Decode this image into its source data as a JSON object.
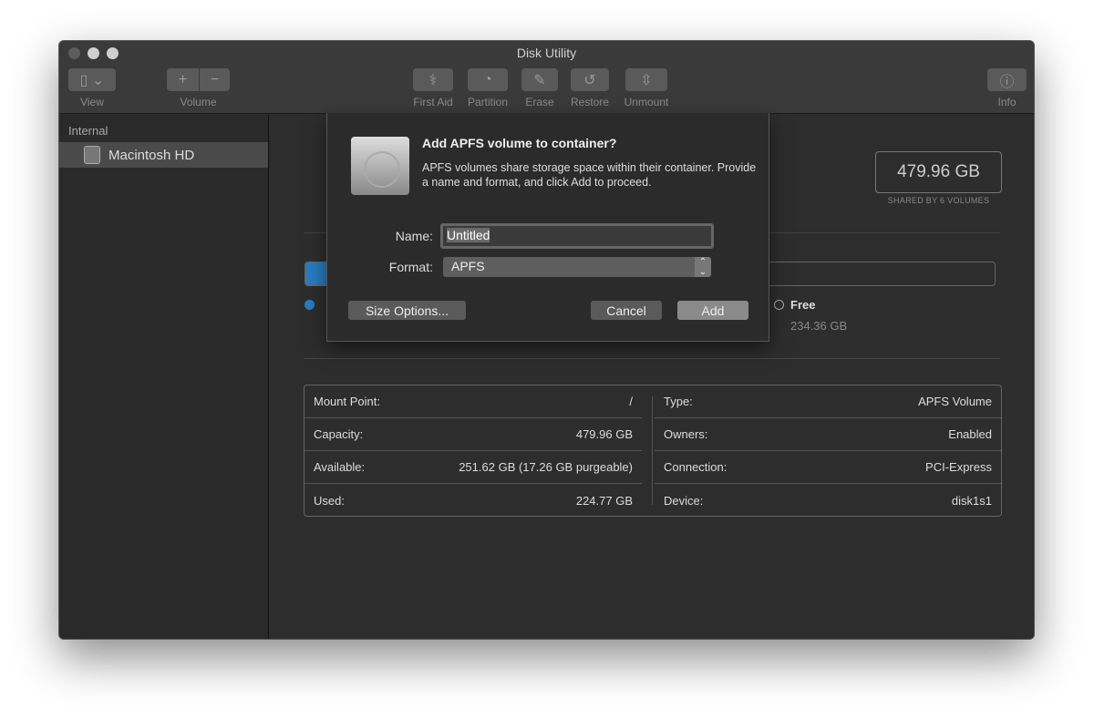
{
  "window": {
    "title": "Disk Utility"
  },
  "toolbar": {
    "view": "View",
    "volume": "Volume",
    "first_aid": "First Aid",
    "partition": "Partition",
    "erase": "Erase",
    "restore": "Restore",
    "unmount": "Unmount",
    "info": "Info"
  },
  "sidebar": {
    "section": "Internal",
    "items": [
      {
        "label": "Macintosh HD",
        "selected": true
      }
    ]
  },
  "main": {
    "capacity": "479.96 GB",
    "shared": "SHARED BY 6 VOLUMES",
    "free_label": "Free",
    "free_value": "234.36 GB",
    "used_color": "#2a7bc0",
    "info_left": [
      {
        "k": "Mount Point:",
        "v": "/"
      },
      {
        "k": "Capacity:",
        "v": "479.96 GB"
      },
      {
        "k": "Available:",
        "v": "251.62 GB (17.26 GB purgeable)"
      },
      {
        "k": "Used:",
        "v": "224.77 GB"
      }
    ],
    "info_right": [
      {
        "k": "Type:",
        "v": "APFS Volume"
      },
      {
        "k": "Owners:",
        "v": "Enabled"
      },
      {
        "k": "Connection:",
        "v": "PCI-Express"
      },
      {
        "k": "Device:",
        "v": "disk1s1"
      }
    ]
  },
  "dialog": {
    "title": "Add APFS volume to container?",
    "text": "APFS volumes share storage space within their container. Provide a name and format, and click Add to proceed.",
    "name_label": "Name:",
    "name_value": "Untitled",
    "format_label": "Format:",
    "format_value": "APFS",
    "size_options": "Size Options...",
    "cancel": "Cancel",
    "add": "Add"
  }
}
